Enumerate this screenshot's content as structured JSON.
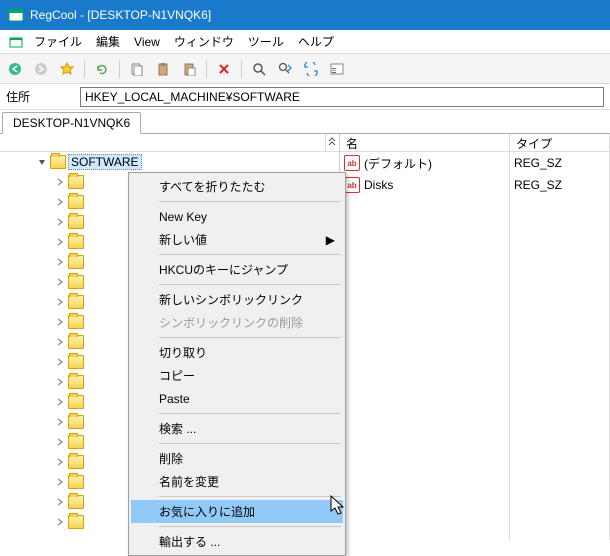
{
  "title": "RegCool - [DESKTOP-N1VNQK6]",
  "menu": {
    "file": "ファイル",
    "edit": "編集",
    "view": "View",
    "window": "ウィンドウ",
    "tools": "ツール",
    "help": "ヘルプ"
  },
  "address": {
    "label": "住所",
    "value": "HKEY_LOCAL_MACHINE¥SOFTWARE"
  },
  "tab": "DESKTOP-N1VNQK6",
  "columns": {
    "name": "名",
    "type": "タイプ"
  },
  "values": [
    {
      "name": "(デフォルト)",
      "type": "REG_SZ"
    },
    {
      "name": "Disks",
      "type": "REG_SZ"
    }
  ],
  "tree_root": "SOFTWARE",
  "ctx": {
    "collapse_all": "すべてを折りたたむ",
    "new_key": "New Key",
    "new_value": "新しい値",
    "jump_hkcu": "HKCUのキーにジャンプ",
    "new_symlink": "新しいシンボリックリンク",
    "del_symlink": "シンボリックリンクの削除",
    "cut": "切り取り",
    "copy": "コピー",
    "paste": "Paste",
    "search": "検索 ...",
    "delete": "削除",
    "rename": "名前を変更",
    "add_fav": "お気に入りに追加",
    "export": "輸出する ..."
  },
  "icons": {
    "app": "regcool-icon",
    "sys": "window-control-icon",
    "back": "back-icon",
    "fwd": "forward-icon",
    "fav": "favorite-icon",
    "refresh": "refresh-icon",
    "copy": "copy-icon",
    "paste": "paste-icon",
    "paste2": "paste-list-icon",
    "delete": "delete-icon",
    "search": "search-icon",
    "searchnext": "search-next-icon",
    "replace": "replace-icon",
    "props": "properties-icon"
  }
}
